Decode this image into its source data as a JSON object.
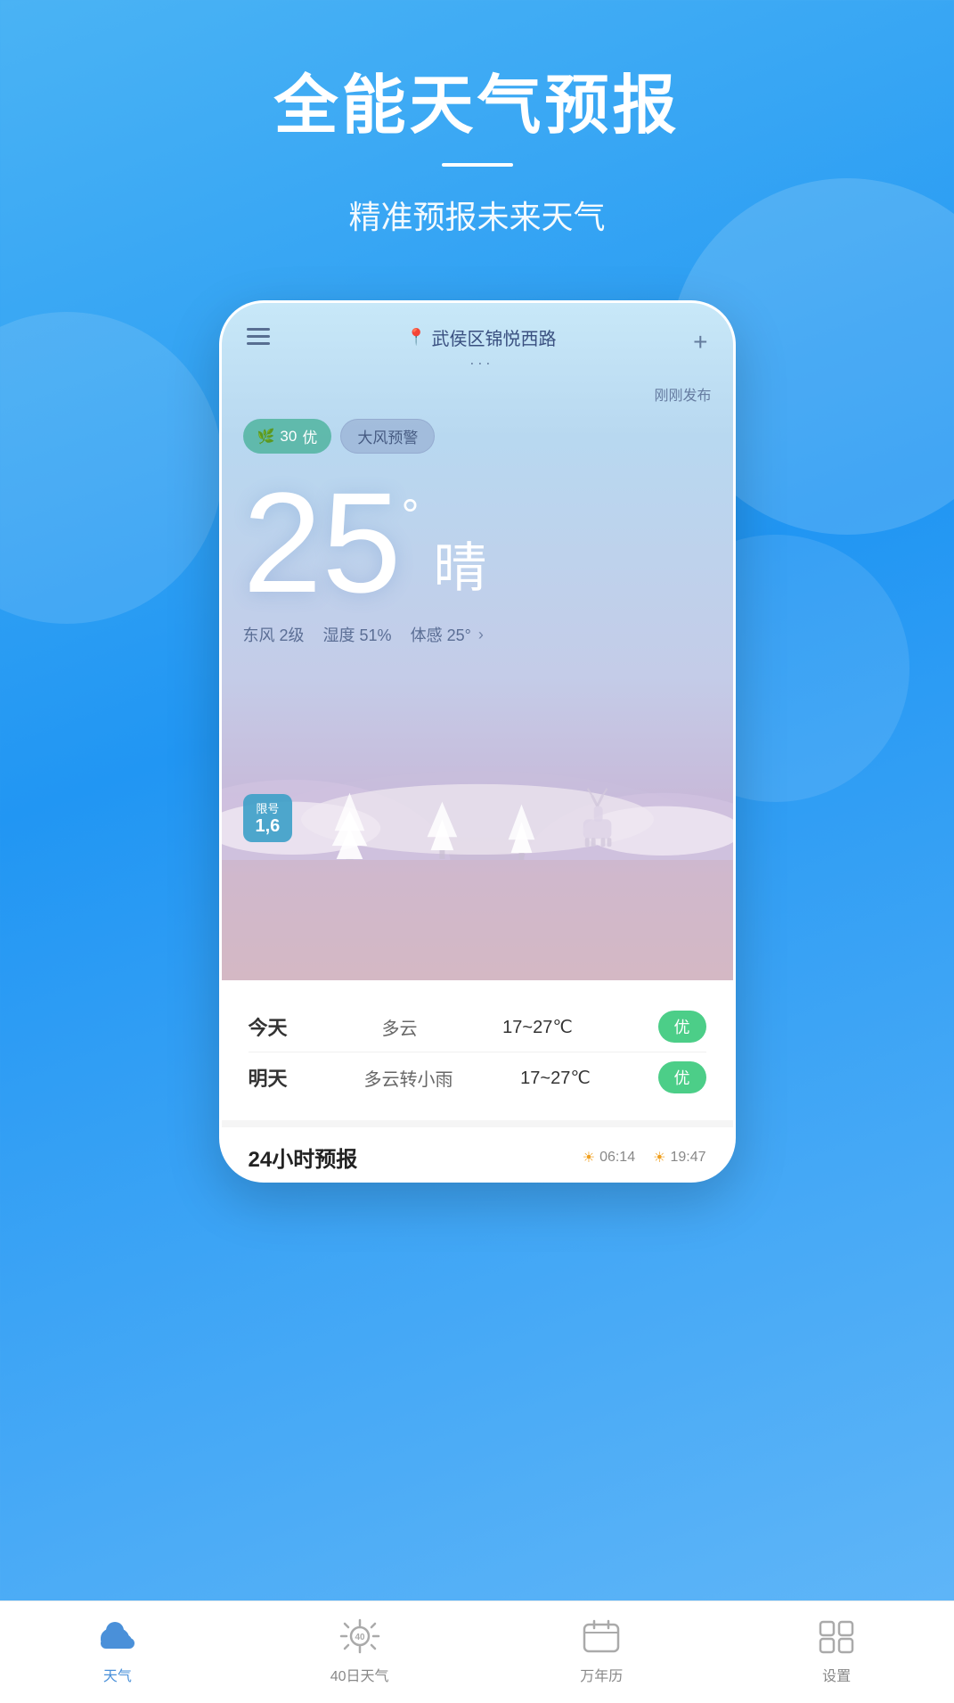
{
  "page": {
    "title": "全能天气预报",
    "divider": "—",
    "subtitle": "精准预报未来天气"
  },
  "phone": {
    "location": "武侯区锦悦西路",
    "just_published": "刚刚发布",
    "aqi": {
      "value": "30",
      "level": "优"
    },
    "warning": "大风预警",
    "temperature": "25",
    "degree_symbol": "°",
    "condition": "晴",
    "details": {
      "wind": "东风 2级",
      "humidity": "湿度 51%",
      "feels_like": "体感 25°"
    },
    "plate_badge": {
      "label": "限号",
      "numbers": "1,6"
    }
  },
  "forecast": {
    "today": {
      "day": "今天",
      "condition": "多云",
      "temp": "17~27℃",
      "quality": "优"
    },
    "tomorrow": {
      "day": "明天",
      "condition": "多云转小雨",
      "temp": "17~27℃",
      "quality": "优"
    }
  },
  "forecast_24h": {
    "title": "24小时预报",
    "sunrise": "06:14",
    "sunset": "19:47"
  },
  "nav": {
    "items": [
      {
        "id": "weather",
        "label": "天气",
        "active": true
      },
      {
        "id": "forecast40",
        "label": "40日天气",
        "active": false
      },
      {
        "id": "calendar",
        "label": "万年历",
        "active": false
      },
      {
        "id": "settings",
        "label": "设置",
        "active": false
      }
    ]
  }
}
